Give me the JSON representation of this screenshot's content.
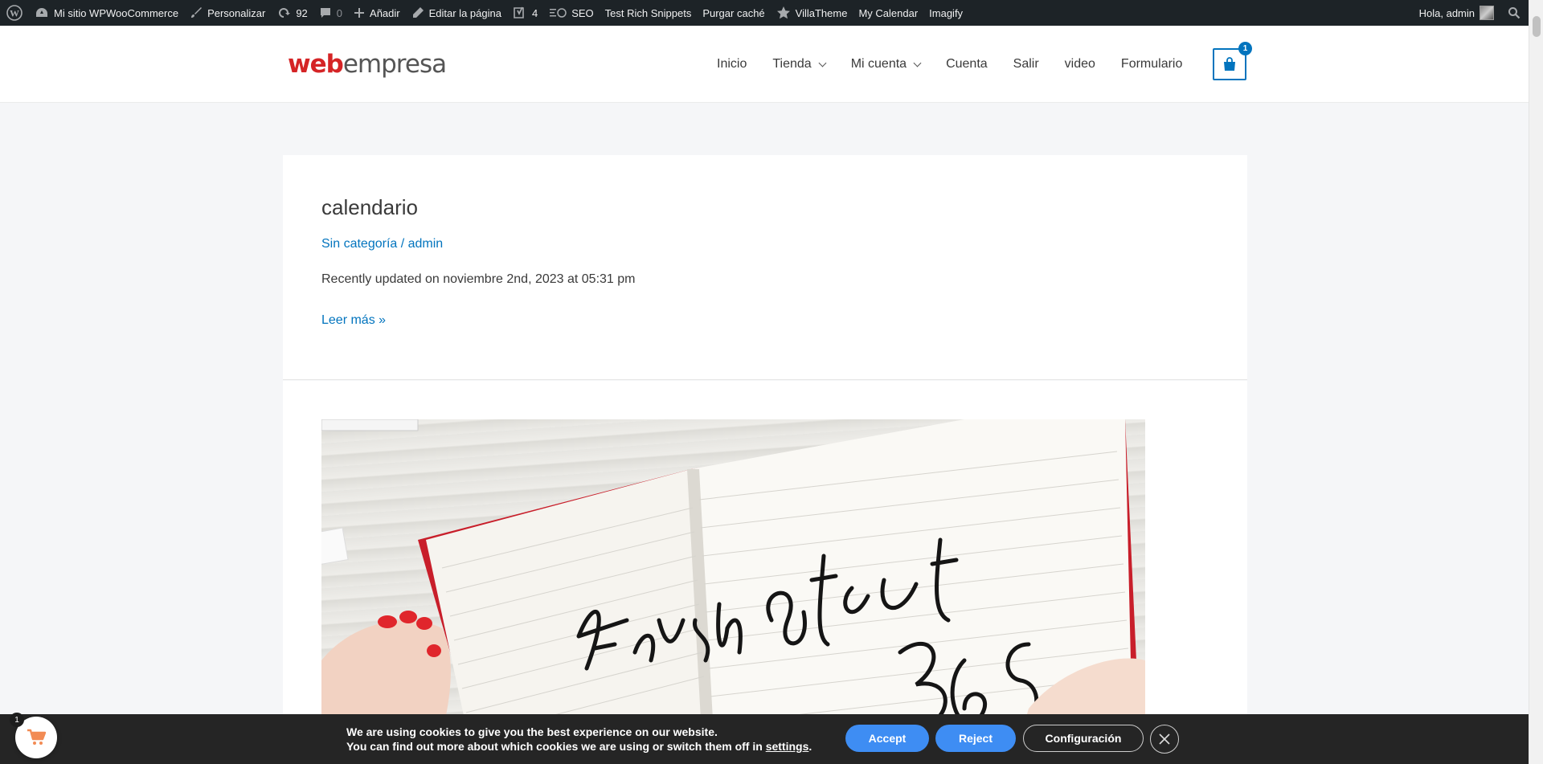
{
  "adminbar": {
    "site_name": "Mi sitio WPWooCommerce",
    "customize": "Personalizar",
    "updates": "92",
    "comments": "0",
    "add_new": "Añadir",
    "edit_page": "Editar la página",
    "yoast_count": "4",
    "seo": "SEO",
    "rich_snippets": "Test Rich Snippets",
    "purge_cache": "Purgar caché",
    "villatheme": "VillaTheme",
    "my_calendar": "My Calendar",
    "imagify": "Imagify",
    "greeting": "Hola, admin"
  },
  "header": {
    "logo_web": "web",
    "logo_empresa": "empresa",
    "nav": [
      "Inicio",
      "Tienda",
      "Mi cuenta",
      "Cuenta",
      "Salir",
      "video",
      "Formulario"
    ],
    "cart_count": "1"
  },
  "post": {
    "title": "calendario",
    "category": "Sin categoría",
    "separator": " / ",
    "author": "admin",
    "updated": "Recently updated on noviembre 2nd, 2023 at 05:31 pm",
    "read_more": "Leer más »"
  },
  "cookie": {
    "line1": "We are using cookies to give you the best experience on our website.",
    "line2_prefix": "You can find out more about which cookies we are using or switch them off in ",
    "line2_link": "settings",
    "line2_suffix": ".",
    "accept": "Accept",
    "reject": "Reject",
    "config": "Configuración"
  },
  "float_cart": {
    "count": "1"
  },
  "colors": {
    "accent": "#0274be",
    "admin_bar": "#1d2327",
    "cookie_button": "#3e8df3",
    "logo_red": "#d52426"
  }
}
